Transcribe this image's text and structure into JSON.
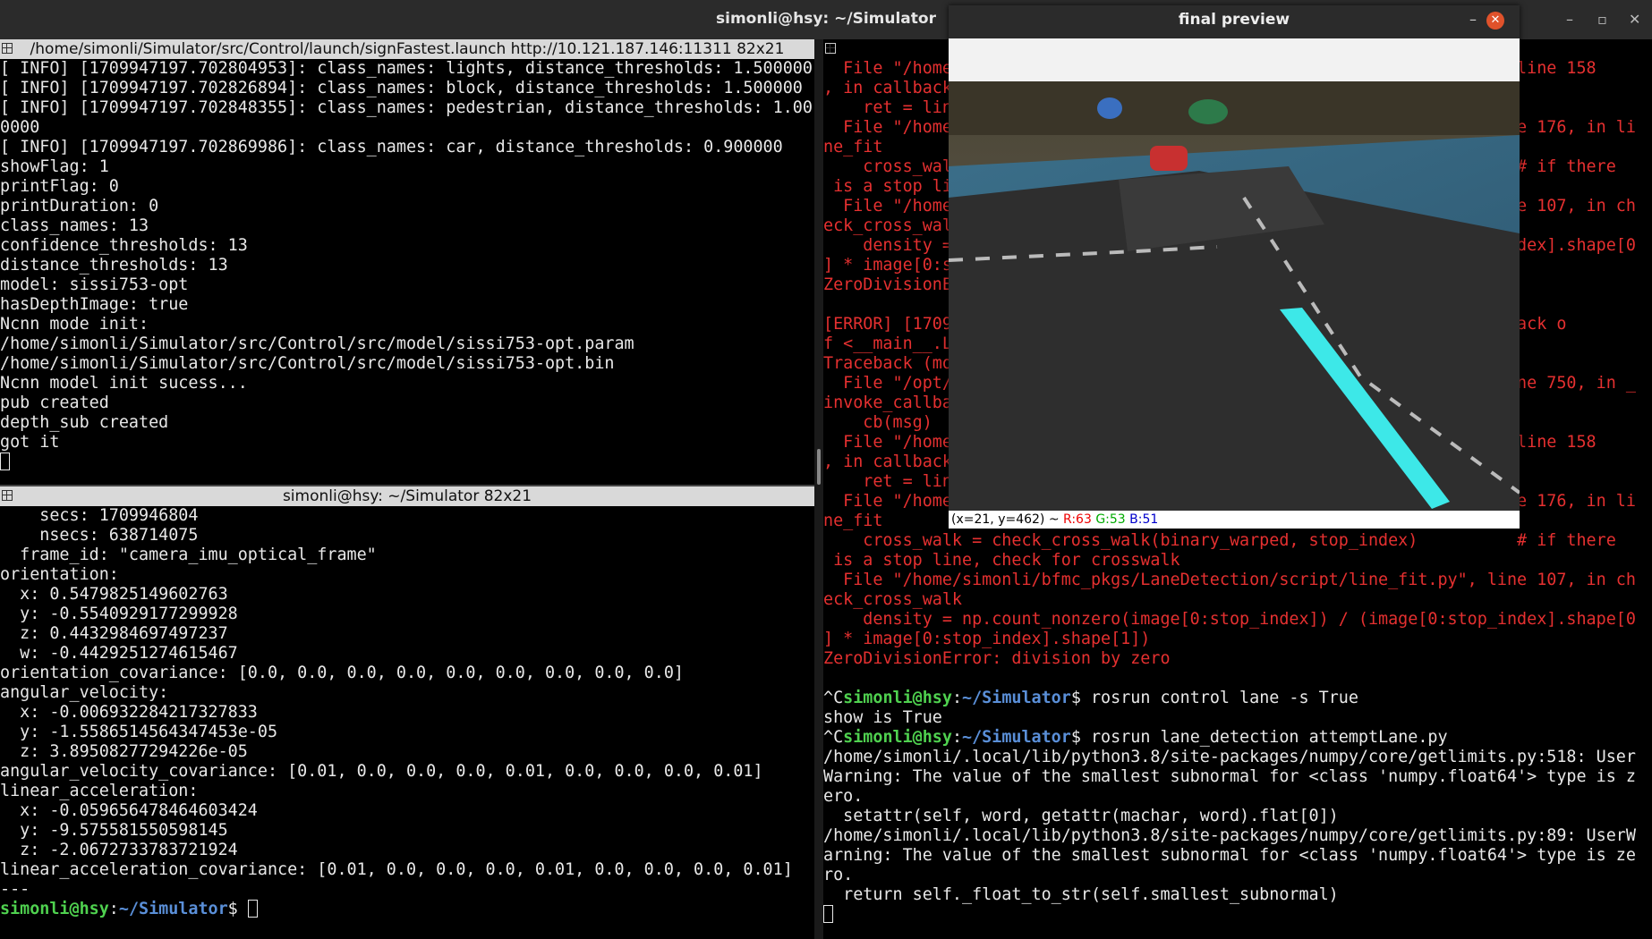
{
  "main_window": {
    "title": "simonli@hsy: ~/Simulator",
    "controls": [
      "–",
      "▫",
      "✕"
    ]
  },
  "pane_top_left": {
    "header": "/home/simonli/Simulator/src/Control/launch/signFastest.launch http://10.121.187.146:11311 82x21",
    "lines": [
      "[ INFO] [1709947197.702804953]: class_names: lights, distance_thresholds: 1.500000",
      "[ INFO] [1709947197.702826894]: class_names: block, distance_thresholds: 1.500000",
      "[ INFO] [1709947197.702848355]: class_names: pedestrian, distance_thresholds: 1.00",
      "0000",
      "[ INFO] [1709947197.702869986]: class_names: car, distance_thresholds: 0.900000",
      "showFlag: 1",
      "printFlag: 0",
      "printDuration: 0",
      "class_names: 13",
      "confidence_thresholds: 13",
      "distance_thresholds: 13",
      "model: sissi753-opt",
      "hasDepthImage: true",
      "Ncnn mode init:",
      "/home/simonli/Simulator/src/Control/src/model/sissi753-opt.param",
      "/home/simonli/Simulator/src/Control/src/model/sissi753-opt.bin",
      "Ncnn model init sucess...",
      "pub created",
      "depth_sub created",
      "got it"
    ]
  },
  "pane_bottom_left": {
    "header": "simonli@hsy: ~/Simulator 82x21",
    "lines": [
      "    secs: 1709946804",
      "    nsecs: 638714075",
      "  frame_id: \"camera_imu_optical_frame\"",
      "orientation:",
      "  x: 0.5479825149602763",
      "  y: -0.5540929177299928",
      "  z: 0.4432984697497237",
      "  w: -0.4429251274615467",
      "orientation_covariance: [0.0, 0.0, 0.0, 0.0, 0.0, 0.0, 0.0, 0.0, 0.0]",
      "angular_velocity:",
      "  x: -0.006932284217327833",
      "  y: -1.5586514564347453e-05",
      "  z: 3.89508277294226e-05",
      "angular_velocity_covariance: [0.01, 0.0, 0.0, 0.0, 0.01, 0.0, 0.0, 0.0, 0.01]",
      "linear_acceleration:",
      "  x: -0.059656478464603424",
      "  y: -9.575581550598145",
      "  z: -2.0672733783721924",
      "linear_acceleration_covariance: [0.01, 0.0, 0.0, 0.0, 0.01, 0.0, 0.0, 0.0, 0.01]",
      "---"
    ],
    "prompt_user": "simonli@hsy",
    "prompt_colon": ":",
    "prompt_path": "~/Simulator",
    "prompt_symbol": "$ "
  },
  "pane_right": {
    "red_lines": [
      "  File \"/home/simonli/bfmc_pkgs/LaneDetection/script/attemptLane.py\", line 158",
      ", in callback",
      "    ret = line_fit(binary_warped)",
      "  File \"/home/simonli/bfmc_pkgs/LaneDetection/script/line_fit.py\", line 176, in li",
      "ne_fit",
      "    cross_walk = check_cross_walk(binary_warped, stop_index)          # if there",
      " is a stop line, check for crosswalk",
      "  File \"/home/simonli/bfmc_pkgs/LaneDetection/script/line_fit.py\", line 107, in ch",
      "eck_cross_walk",
      "    density = np.count_nonzero(image[0:stop_index]) / (image[0:stop_index].shape[0",
      "] * image[0:stop_index].shape[1])",
      "ZeroDivisionError: division by zero",
      "",
      "[ERROR] [1709947197.702869986]: bad callback: <bound method Lane.callback o",
      "f <__main__.Lane object at 0x7f>>",
      "Traceback (most recent call last):",
      "  File \"/opt/ros/noetic/lib/python3/dist-packages/rospy/topics.py\", line 750, in _",
      "invoke_callback",
      "    cb(msg)",
      "  File \"/home/simonli/bfmc_pkgs/LaneDetection/script/attemptLane.py\", line 158",
      ", in callback",
      "    ret = line_fit(binary_warped)",
      "  File \"/home/simonli/bfmc_pkgs/LaneDetection/script/line_fit.py\", line 176, in li",
      "ne_fit",
      "    cross_walk = check_cross_walk(binary_warped, stop_index)          # if there",
      " is a stop line, check for crosswalk",
      "  File \"/home/simonli/bfmc_pkgs/LaneDetection/script/line_fit.py\", line 107, in ch",
      "eck_cross_walk",
      "    density = np.count_nonzero(image[0:stop_index]) / (image[0:stop_index].shape[0",
      "] * image[0:stop_index].shape[1])",
      "ZeroDivisionError: division by zero"
    ],
    "cmd1_prefix": "^C",
    "cmd1": " rosrun control lane -s True",
    "out1": "show is True",
    "cmd2_prefix": "^C",
    "cmd2": " rosrun lane_detection attemptLane.py",
    "warn_lines": [
      "/home/simonli/.local/lib/python3.8/site-packages/numpy/core/getlimits.py:518: User",
      "Warning: The value of the smallest subnormal for <class 'numpy.float64'> type is z",
      "ero.",
      "  setattr(self, word, getattr(machar, word).flat[0])",
      "/home/simonli/.local/lib/python3.8/site-packages/numpy/core/getlimits.py:89: UserW",
      "arning: The value of the smallest subnormal for <class 'numpy.float64'> type is ze",
      "ro.",
      "  return self._float_to_str(self.smallest_subnormal)"
    ],
    "prompt_user": "simonli@hsy",
    "prompt_colon": ":",
    "prompt_path": "~/Simulator",
    "prompt_symbol": "$"
  },
  "preview_window": {
    "title": "final preview",
    "buttons": [
      "–",
      "▫",
      "✕"
    ],
    "status_coords": "(x=21, y=462) ~ ",
    "status_r": "R:63",
    "status_g": "G:53",
    "status_b": "B:51"
  },
  "colors": {
    "error_text": "#e53030",
    "prompt_user": "#4fd14f",
    "prompt_path": "#5a8fd8",
    "lane_overlay": "#3de8e8"
  }
}
